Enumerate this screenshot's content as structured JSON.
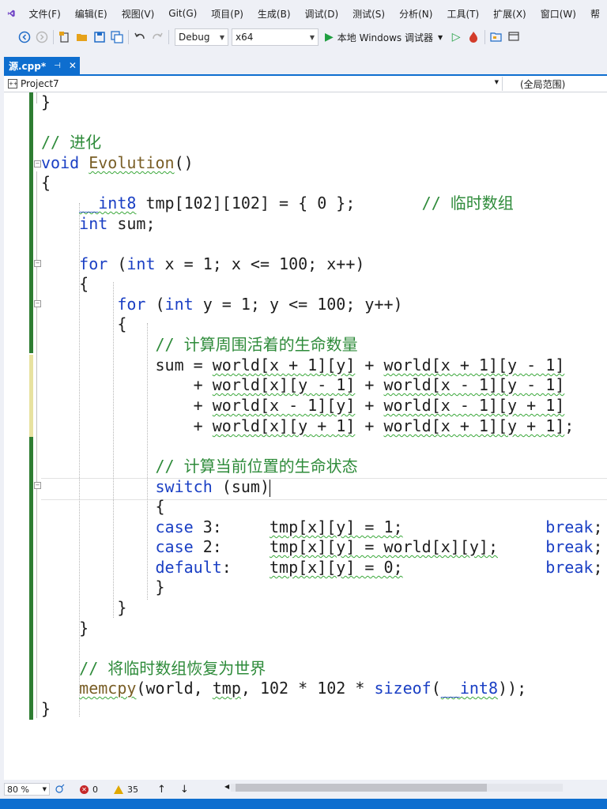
{
  "menu": [
    "文件(F)",
    "编辑(E)",
    "视图(V)",
    "Git(G)",
    "项目(P)",
    "生成(B)",
    "调试(D)",
    "测试(S)",
    "分析(N)",
    "工具(T)",
    "扩展(X)",
    "窗口(W)",
    "帮"
  ],
  "toolbar": {
    "config": "Debug",
    "platform": "x64",
    "run_label": "本地 Windows 调试器",
    "icons": [
      "back-icon",
      "forward-icon",
      "new-project-icon",
      "open-file-icon",
      "save-icon",
      "save-all-icon",
      "undo-icon",
      "redo-icon",
      "play-icon",
      "start-without-debug-icon",
      "hot-reload-icon",
      "solution-explorer-icon",
      "window-layout-icon"
    ]
  },
  "tab": {
    "name": "源.cpp*",
    "pin": "⊣",
    "close": "✕"
  },
  "nav": {
    "project": "Project7",
    "scope": "(全局范围)"
  },
  "code": {
    "l0": "}",
    "l1_comment": "// 进化",
    "l2_void": "void",
    "l2_fn": "Evolution",
    "l2_paren": "()",
    "l3": "{",
    "l4_type": "__int8",
    "l4_rest": " tmp[102][102] = { 0 };",
    "l4_comment": "// 临时数组",
    "l5_type": "int",
    "l5_rest": " sum;",
    "l6_for": "for",
    "l6_a": " (",
    "l6_int": "int",
    "l6_b": " x = 1; x <= 100; x++)",
    "l7": "{",
    "l8_for": "for",
    "l8_a": " (",
    "l8_int": "int",
    "l8_b": " y = 1; y <= 100; y++)",
    "l9": "{",
    "l10_comment": "// 计算周围活着的生命数量",
    "l11_a": "sum = ",
    "l11_b": "world[x + 1][y]",
    "l11_c": " + ",
    "l11_d": "world[x + 1][y - 1]",
    "l12_a": "+ ",
    "l12_b": "world[x][y - 1]",
    "l12_c": " + ",
    "l12_d": "world[x - 1][y - 1]",
    "l13_a": "+ ",
    "l13_b": "world[x - 1][y]",
    "l13_c": " + ",
    "l13_d": "world[x - 1][y + 1]",
    "l14_a": "+ ",
    "l14_b": "world[x][y + 1]",
    "l14_c": " + ",
    "l14_d": "world[x + 1][y + 1]",
    "l14_e": ";",
    "l15_comment": "// 计算当前位置的生命状态",
    "l16_switch": "switch",
    "l16_rest": " (sum)",
    "l17": "{",
    "l18_case": "case",
    "l18_a": " 3:",
    "l18_b": "tmp[x][y] = 1;",
    "l18_break": "break",
    "l18_semi": ";",
    "l19_case": "case",
    "l19_a": " 2:",
    "l19_b": "tmp[x][y] = world[x][y];",
    "l19_break": "break",
    "l19_semi": ";",
    "l20_default": "default",
    "l20_a": ":",
    "l20_b": "tmp[x][y] = 0;",
    "l20_break": "break",
    "l20_semi": ";",
    "l21": "}",
    "l22": "}",
    "l23": "}",
    "l24_comment": "// 将临时数组恢复为世界",
    "l25_fn": "memcpy",
    "l25_a": "(world, ",
    "l25_b": "tmp",
    "l25_c": ", 102 * 102 * ",
    "l25_sizeof": "sizeof",
    "l25_d": "(",
    "l25_type": "__int8",
    "l25_e": "));",
    "l26": "}"
  },
  "status": {
    "zoom": "80 %",
    "errors": "0",
    "warnings": "35"
  }
}
